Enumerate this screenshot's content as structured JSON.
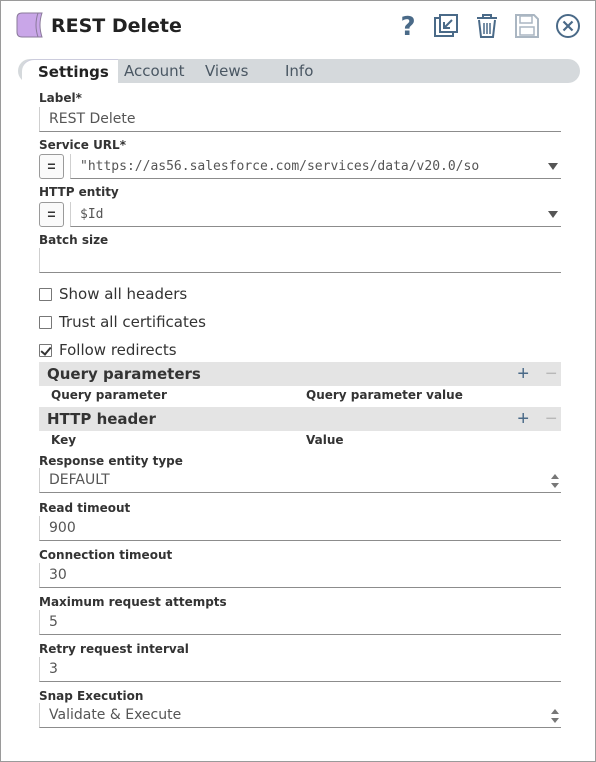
{
  "header": {
    "title": "REST Delete",
    "snap_icon": "snap-purple-icon",
    "icons": [
      "help-icon",
      "export-icon",
      "delete-icon",
      "save-icon",
      "close-icon"
    ],
    "accent_color": "#c9a6e8"
  },
  "tabs": [
    {
      "label": "Settings",
      "active": true
    },
    {
      "label": "Account",
      "active": false
    },
    {
      "label": "Views",
      "active": false
    },
    {
      "label": "Info",
      "active": false
    }
  ],
  "form": {
    "label": {
      "label": "Label*",
      "value": "REST Delete"
    },
    "service_url": {
      "label": "Service URL*",
      "expr_btn": "=",
      "value": "\"https://as56.salesforce.com/services/data/v20.0/so"
    },
    "http_entity": {
      "label": "HTTP entity",
      "expr_btn": "=",
      "value": "$Id"
    },
    "batch_size": {
      "label": "Batch size",
      "value": ""
    },
    "show_all_headers": {
      "label": "Show all headers",
      "checked": false
    },
    "trust_all_certificates": {
      "label": "Trust all certificates",
      "checked": false
    },
    "follow_redirects": {
      "label": "Follow redirects",
      "checked": true
    },
    "query_parameters": {
      "title": "Query parameters",
      "add": "+",
      "remove": "−",
      "columns": [
        "Query parameter",
        "Query parameter value"
      ]
    },
    "http_header": {
      "title": "HTTP header",
      "add": "+",
      "remove": "−",
      "columns": [
        "Key",
        "Value"
      ]
    },
    "response_entity_type": {
      "label": "Response entity type",
      "value": "DEFAULT"
    },
    "read_timeout": {
      "label": "Read timeout",
      "value": "900"
    },
    "connection_timeout": {
      "label": "Connection timeout",
      "value": "30"
    },
    "max_request_attempts": {
      "label": "Maximum request attempts",
      "value": "5"
    },
    "retry_request_interval": {
      "label": "Retry request interval",
      "value": "3"
    },
    "snap_execution": {
      "label": "Snap Execution",
      "value": "Validate & Execute"
    }
  }
}
